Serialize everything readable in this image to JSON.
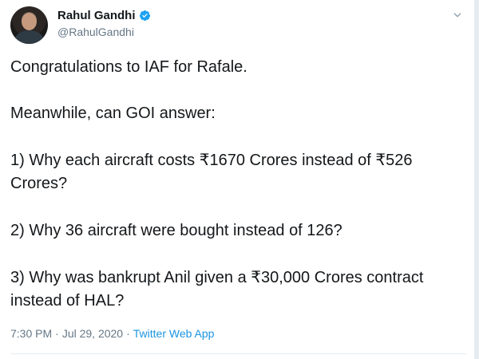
{
  "author": {
    "display_name": "Rahul Gandhi",
    "handle": "@RahulGandhi",
    "verified_icon": "verified-badge-icon",
    "avatar_icon": "profile-photo"
  },
  "menu": {
    "icon": "chevron-down-icon"
  },
  "tweet": {
    "line1": "Congratulations to IAF for Rafale.",
    "line2": "Meanwhile, can GOI answer:",
    "line3": "1) Why each aircraft costs ₹1670 Crores instead of ₹526 Crores?",
    "line4": "2) Why 36 aircraft were bought instead of 126?",
    "line5": "3) Why was bankrupt Anil given a ₹30,000 Crores contract instead of HAL?"
  },
  "meta": {
    "time": "7:30 PM",
    "separator": "·",
    "date": "Jul 29, 2020",
    "source": "Twitter Web App"
  },
  "colors": {
    "verified": "#1da1f2",
    "link": "#1b95e0",
    "muted": "#657786",
    "text": "#14171a"
  }
}
